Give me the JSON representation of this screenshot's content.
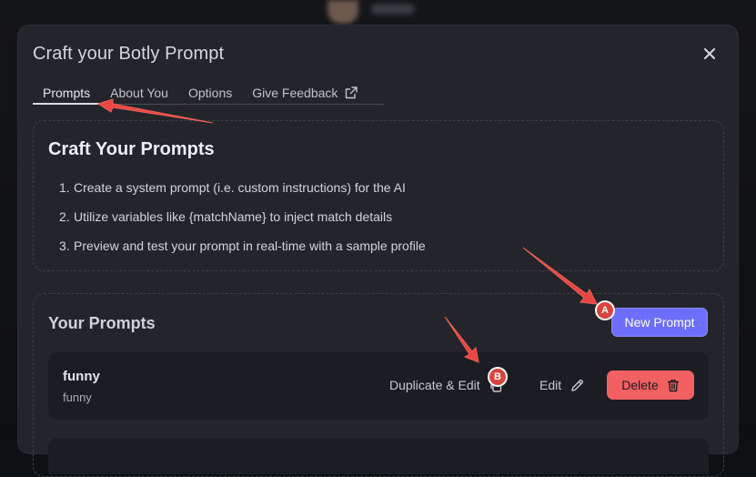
{
  "modal": {
    "title": "Craft your Botly Prompt"
  },
  "tabs": [
    {
      "label": "Prompts",
      "active": true
    },
    {
      "label": "About You"
    },
    {
      "label": "Options"
    },
    {
      "label": "Give Feedback",
      "icon": "external-link-icon"
    }
  ],
  "craft": {
    "heading": "Craft Your Prompts",
    "steps": [
      {
        "num": "1.",
        "text": "Create a system prompt (i.e. custom instructions) for the AI"
      },
      {
        "num": "2.",
        "text": "Utilize variables like {matchName} to inject match details"
      },
      {
        "num": "3.",
        "text": "Preview and test your prompt in real-time with a sample profile"
      }
    ]
  },
  "prompts": {
    "heading": "Your Prompts",
    "new_button": "New Prompt",
    "items": [
      {
        "name": "funny",
        "description": "funny",
        "duplicate_label": "Duplicate & Edit",
        "edit_label": "Edit",
        "delete_label": "Delete"
      }
    ]
  },
  "annotations": {
    "badge_a": "A",
    "badge_b": "B",
    "arrow_color": "#e8463f"
  },
  "colors": {
    "primary": "#6d6efc",
    "danger": "#f26061",
    "modal_bg": "#23252b"
  }
}
